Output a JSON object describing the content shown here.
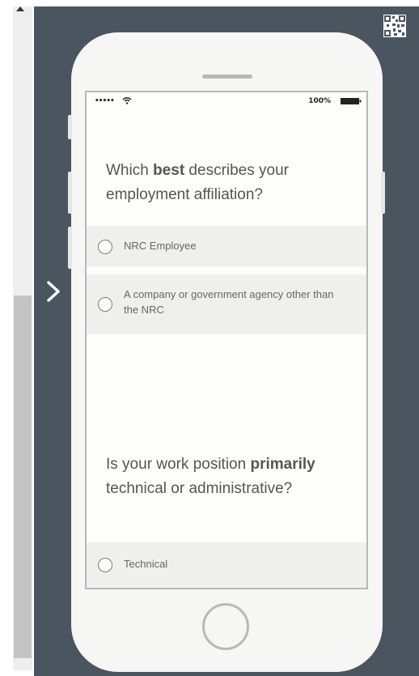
{
  "status_bar": {
    "signal": "•••••",
    "battery": "100%"
  },
  "questions": [
    {
      "prefix": "Which ",
      "emphasis": "best",
      "suffix": " describes your employment affiliation?",
      "options": [
        "NRC Employee",
        "A company or government agency other than the NRC"
      ]
    },
    {
      "prefix": "Is your work position ",
      "emphasis": "primarily",
      "suffix": " technical or administrative?",
      "options": [
        "Technical"
      ]
    }
  ],
  "icons": {
    "scroll_up": "triangle-up-icon",
    "next": "chevron-right-icon",
    "qr": "qr-code-icon",
    "wifi": "wifi-icon",
    "battery": "battery-icon"
  },
  "colors": {
    "stage": "#4a5560",
    "phone_body": "#f6f6f4",
    "option_bg": "#efefec",
    "text": "#555555"
  }
}
